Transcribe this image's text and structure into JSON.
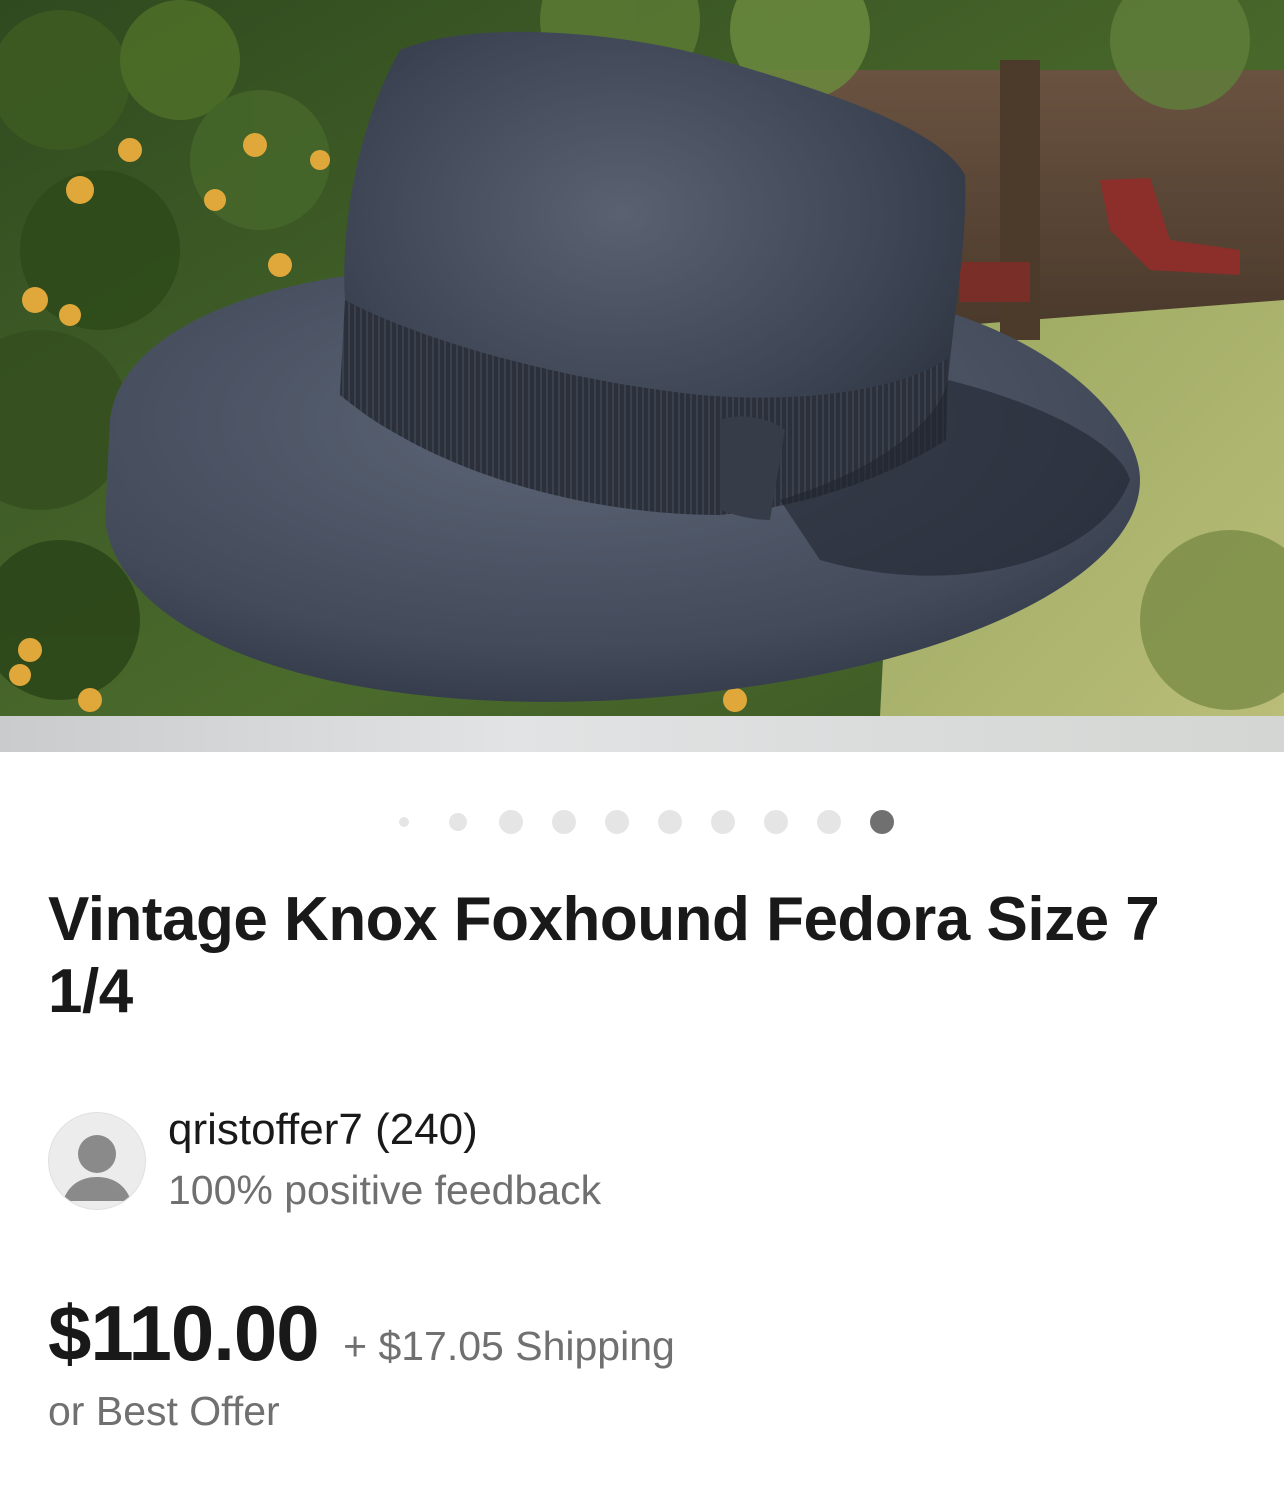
{
  "listing": {
    "title": "Vintage Knox Foxhound Fedora Size 7 1/4",
    "image_subject": "navy fedora hat",
    "carousel": {
      "count": 10,
      "active_index": 9,
      "active_color": "#707070",
      "inactive_color": "#e5e5e5"
    }
  },
  "seller": {
    "name_and_score": "qristoffer7 (240)",
    "feedback": "100% positive feedback",
    "avatar_icon": "default-user-avatar-icon"
  },
  "pricing": {
    "price": "$110.00",
    "shipping": "+ $17.05 Shipping",
    "best_offer": "or Best Offer"
  }
}
